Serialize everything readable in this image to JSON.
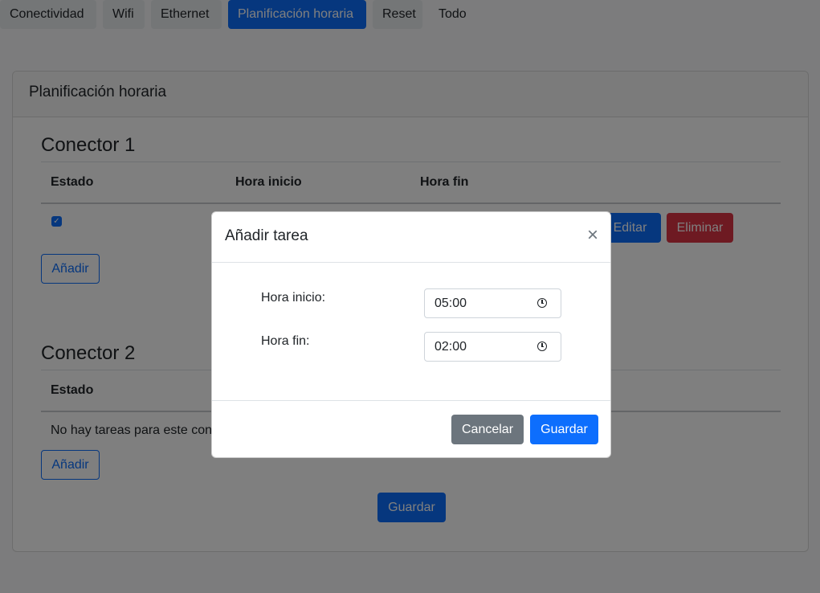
{
  "tabs": [
    {
      "label": "Conectividad"
    },
    {
      "label": "Wifi"
    },
    {
      "label": "Ethernet"
    },
    {
      "label": "Planificación horaria"
    },
    {
      "label": "Reset"
    },
    {
      "label": "Todo"
    }
  ],
  "card": {
    "header": "Planificación horaria",
    "conector1": {
      "title": "Conector 1",
      "columns": [
        "Estado",
        "Hora inicio",
        "Hora fin"
      ],
      "row": {
        "estado_checked": true,
        "edit_label": "Editar",
        "delete_label": "Eliminar"
      },
      "add_label": "Añadir"
    },
    "conector2": {
      "title": "Conector 2",
      "columns": [
        "Estado"
      ],
      "empty_text": "No hay tareas para este con",
      "add_label": "Añadir"
    },
    "save_label": "Guardar"
  },
  "modal": {
    "title": "Añadir tarea",
    "close_glyph": "×",
    "hora_inicio_label": "Hora inicio:",
    "hora_inicio_value": "05:00",
    "hora_fin_label": "Hora fin:",
    "hora_fin_value": "02:00",
    "cancel_label": "Cancelar",
    "save_label": "Guardar"
  },
  "colors": {
    "primary": "#0d6efd",
    "danger": "#dc3545",
    "secondary": "#6c757d"
  }
}
